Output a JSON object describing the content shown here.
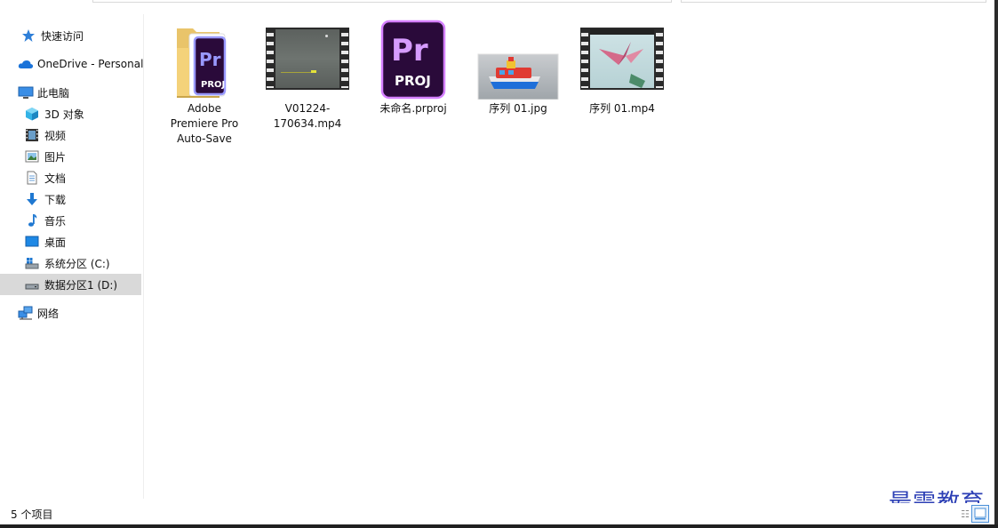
{
  "sidebar": {
    "items": [
      {
        "label": "快速访问",
        "icon": "star-icon"
      },
      {
        "label": "OneDrive - Personal",
        "icon": "cloud-icon"
      },
      {
        "label": "此电脑",
        "icon": "computer-icon"
      },
      {
        "label": "3D 对象",
        "icon": "cube-icon"
      },
      {
        "label": "视频",
        "icon": "video-icon"
      },
      {
        "label": "图片",
        "icon": "picture-icon"
      },
      {
        "label": "文档",
        "icon": "document-icon"
      },
      {
        "label": "下载",
        "icon": "download-icon"
      },
      {
        "label": "音乐",
        "icon": "music-icon"
      },
      {
        "label": "桌面",
        "icon": "desktop-icon"
      },
      {
        "label": "系统分区 (C:)",
        "icon": "drive-c-icon"
      },
      {
        "label": "数据分区1 (D:)",
        "icon": "drive-icon",
        "selected": true
      },
      {
        "label": "网络",
        "icon": "network-icon"
      }
    ]
  },
  "files": [
    {
      "name": "Adobe Premiere Pro Auto-Save",
      "type": "folder"
    },
    {
      "name": "V01224-170634.mp4",
      "type": "video"
    },
    {
      "name": "未命名.prproj",
      "type": "prproj"
    },
    {
      "name": "序列 01.jpg",
      "type": "image"
    },
    {
      "name": "序列 01.mp4",
      "type": "video"
    }
  ],
  "icons": {
    "pr_text": "Pr",
    "proj_text": "PROJ"
  },
  "status": {
    "item_count": "5 个项目"
  },
  "watermark": "最需教育",
  "colors": {
    "selected_bg": "#d9d9d9",
    "pr_purple": "#9999ff",
    "pr_dark": "#2a0a3a",
    "watermark": "#2c3fb5"
  }
}
